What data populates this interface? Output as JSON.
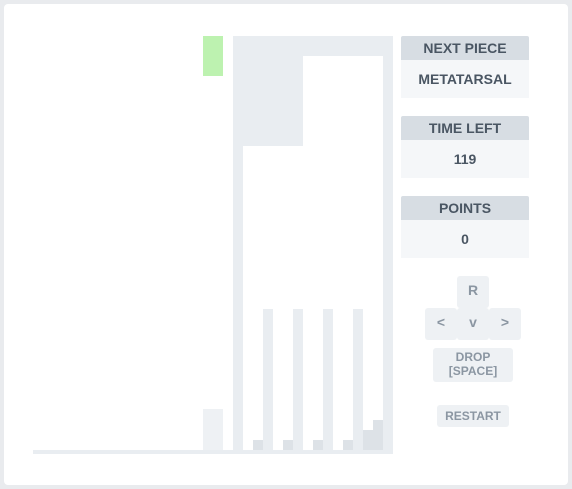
{
  "game": {
    "next_piece": {
      "label": "NEXT PIECE",
      "value": "METATARSAL"
    },
    "time_left": {
      "label": "TIME LEFT",
      "value": "119"
    },
    "points": {
      "label": "POINTS",
      "value": "0"
    }
  },
  "controls": {
    "rotate": "R",
    "left": "<",
    "down": "v",
    "right": ">",
    "drop_line1": "DROP",
    "drop_line2": "[SPACE]",
    "restart": "RESTART"
  },
  "colors": {
    "falling_piece": "#bdf2b0",
    "panel_header": "#d7dde3",
    "panel_body": "#f5f7f9",
    "board_wall": "#e9edf1"
  }
}
